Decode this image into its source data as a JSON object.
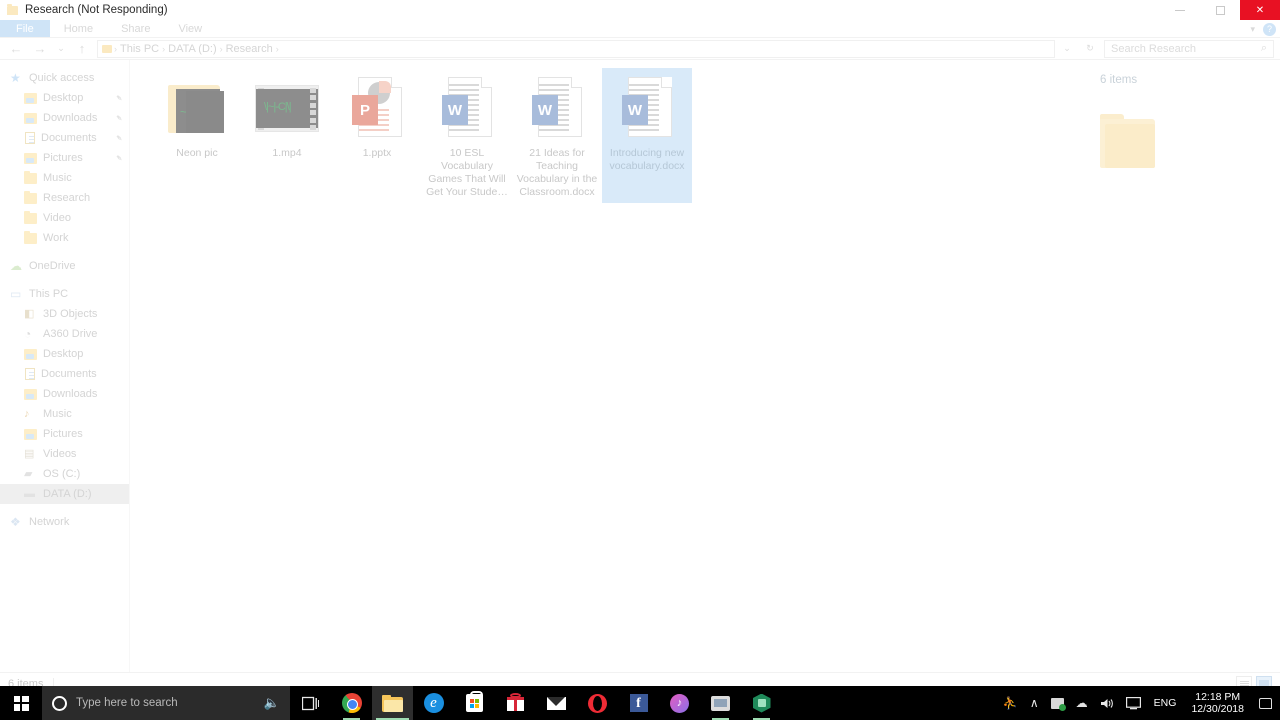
{
  "window": {
    "title": "Research (Not Responding)",
    "minimize_label": "Minimize",
    "maximize_label": "Maximize",
    "close_label": "Close"
  },
  "ribbon": {
    "tabs": [
      "File",
      "Home",
      "Share",
      "View"
    ],
    "expand_icon": "chevron-down-icon",
    "help_icon": "help-icon",
    "help_label": "?"
  },
  "addressbar": {
    "back_icon": "←",
    "forward_icon": "→",
    "recent_icon": "⌄",
    "up_icon": "↑",
    "breadcrumbs": [
      "This PC",
      "DATA (D:)",
      "Research"
    ],
    "separator": "›",
    "dropdown_icon": "⌄",
    "refresh_icon": "↻",
    "search_placeholder": "Search Research",
    "search_icon": "⌕"
  },
  "sidebar": {
    "groups": [
      {
        "name": "Quick access",
        "icon": "star-icon",
        "icon_class": "ic-star",
        "glyph": "★",
        "items": [
          {
            "label": "Desktop",
            "icon": "desktop-folder-icon",
            "icon_class": "ic-blue",
            "pinned": true
          },
          {
            "label": "Downloads",
            "icon": "downloads-folder-icon",
            "icon_class": "ic-blue",
            "pinned": true
          },
          {
            "label": "Documents",
            "icon": "documents-folder-icon",
            "icon_class": "ic-doc",
            "pinned": true
          },
          {
            "label": "Pictures",
            "icon": "pictures-folder-icon",
            "icon_class": "ic-blue",
            "pinned": true
          },
          {
            "label": "Music",
            "icon": "folder-icon",
            "icon_class": "ic-folder",
            "pinned": false
          },
          {
            "label": "Research",
            "icon": "folder-icon",
            "icon_class": "ic-folder",
            "pinned": false
          },
          {
            "label": "Video",
            "icon": "folder-icon",
            "icon_class": "ic-folder",
            "pinned": false
          },
          {
            "label": "Work",
            "icon": "folder-icon",
            "icon_class": "ic-folder",
            "pinned": false
          }
        ]
      },
      {
        "name": "OneDrive",
        "icon": "onedrive-cloud-icon",
        "icon_class": "ic-cloud",
        "glyph": "☁",
        "items": []
      },
      {
        "name": "This PC",
        "icon": "this-pc-icon",
        "icon_class": "ic-pc",
        "glyph": "▭",
        "items": [
          {
            "label": "3D Objects",
            "icon": "3d-objects-icon",
            "icon_class": "ic-3d",
            "glyph": "◧",
            "pinned": false
          },
          {
            "label": "A360 Drive",
            "icon": "a360-drive-icon",
            "icon_class": "ic-a360",
            "glyph": "◔",
            "pinned": false
          },
          {
            "label": "Desktop",
            "icon": "desktop-folder-icon",
            "icon_class": "ic-blue",
            "pinned": false
          },
          {
            "label": "Documents",
            "icon": "documents-folder-icon",
            "icon_class": "ic-doc",
            "pinned": false
          },
          {
            "label": "Downloads",
            "icon": "downloads-folder-icon",
            "icon_class": "ic-blue",
            "pinned": false
          },
          {
            "label": "Music",
            "icon": "music-folder-icon",
            "icon_class": "ic-music",
            "glyph": "♪",
            "pinned": false
          },
          {
            "label": "Pictures",
            "icon": "pictures-folder-icon",
            "icon_class": "ic-blue",
            "pinned": false
          },
          {
            "label": "Videos",
            "icon": "videos-folder-icon",
            "icon_class": "ic-video",
            "glyph": "▤",
            "pinned": false
          },
          {
            "label": "OS (C:)",
            "icon": "os-drive-icon",
            "icon_class": "ic-drive",
            "glyph": "▰",
            "pinned": false
          },
          {
            "label": "DATA (D:)",
            "icon": "data-drive-icon",
            "icon_class": "ic-drive",
            "glyph": "▬",
            "pinned": false,
            "selected": true
          }
        ]
      },
      {
        "name": "Network",
        "icon": "network-icon",
        "icon_class": "ic-net",
        "glyph": "❖",
        "items": []
      }
    ],
    "pin_glyph": "✒"
  },
  "files": [
    {
      "name": "Neon pic",
      "type": "folder-with-preview",
      "selected": false
    },
    {
      "name": "1.mp4",
      "type": "video",
      "selected": false
    },
    {
      "name": "1.pptx",
      "type": "powerpoint",
      "badge": "P",
      "selected": false
    },
    {
      "name": "10 ESL Vocabulary Games That Will Get Your Stude…",
      "type": "word",
      "badge": "W",
      "selected": false
    },
    {
      "name": "21 Ideas for Teaching Vocabulary in the Classroom.docx",
      "type": "word",
      "badge": "W",
      "selected": false
    },
    {
      "name": "Introducing new vocabulary.docx",
      "type": "word",
      "badge": "W",
      "selected": true
    }
  ],
  "details_pane": {
    "item_count": "6 items",
    "folder_icon": "large-folder-icon"
  },
  "statusbar": {
    "item_count": "6 items",
    "details_view_icon": "details-view-icon",
    "thumbnail_view_icon": "large-icons-view-icon"
  },
  "taskbar": {
    "start_icon": "windows-start-icon",
    "search_placeholder": "Type here to search",
    "cortana_icon": "cortana-circle-icon",
    "mic_icon": "🎙",
    "taskview_icon": "task-view-icon",
    "apps": [
      {
        "name": "Google Chrome",
        "icon": "chrome-icon",
        "running": true,
        "active": false
      },
      {
        "name": "File Explorer",
        "icon": "file-explorer-icon",
        "running": true,
        "active": true
      },
      {
        "name": "Microsoft Edge",
        "icon": "edge-icon",
        "running": false,
        "active": false
      },
      {
        "name": "Microsoft Store",
        "icon": "store-icon",
        "running": false,
        "active": false
      },
      {
        "name": "Rewards",
        "icon": "gift-icon",
        "running": false,
        "active": false
      },
      {
        "name": "Mail",
        "icon": "mail-icon",
        "running": false,
        "active": false
      },
      {
        "name": "Opera",
        "icon": "opera-icon",
        "running": false,
        "active": false
      },
      {
        "name": "Facebook",
        "icon": "facebook-icon",
        "running": false,
        "active": false
      },
      {
        "name": "iTunes",
        "icon": "itunes-icon",
        "running": false,
        "active": false
      },
      {
        "name": "Monitor App",
        "icon": "monitor-icon",
        "running": true,
        "active": false
      },
      {
        "name": "Hex App",
        "icon": "hex-app-icon",
        "running": true,
        "active": false
      }
    ],
    "tray": {
      "people_icon": "people-icon",
      "people_glyph": "⛹",
      "chevron_glyph": "∧",
      "onedrive_glyph": "☁",
      "volume_glyph": "🔊",
      "display_glyph": "▭",
      "language": "ENG",
      "time": "12:18 PM",
      "date": "12/30/2018",
      "notification_icon": "notification-center-icon"
    }
  }
}
